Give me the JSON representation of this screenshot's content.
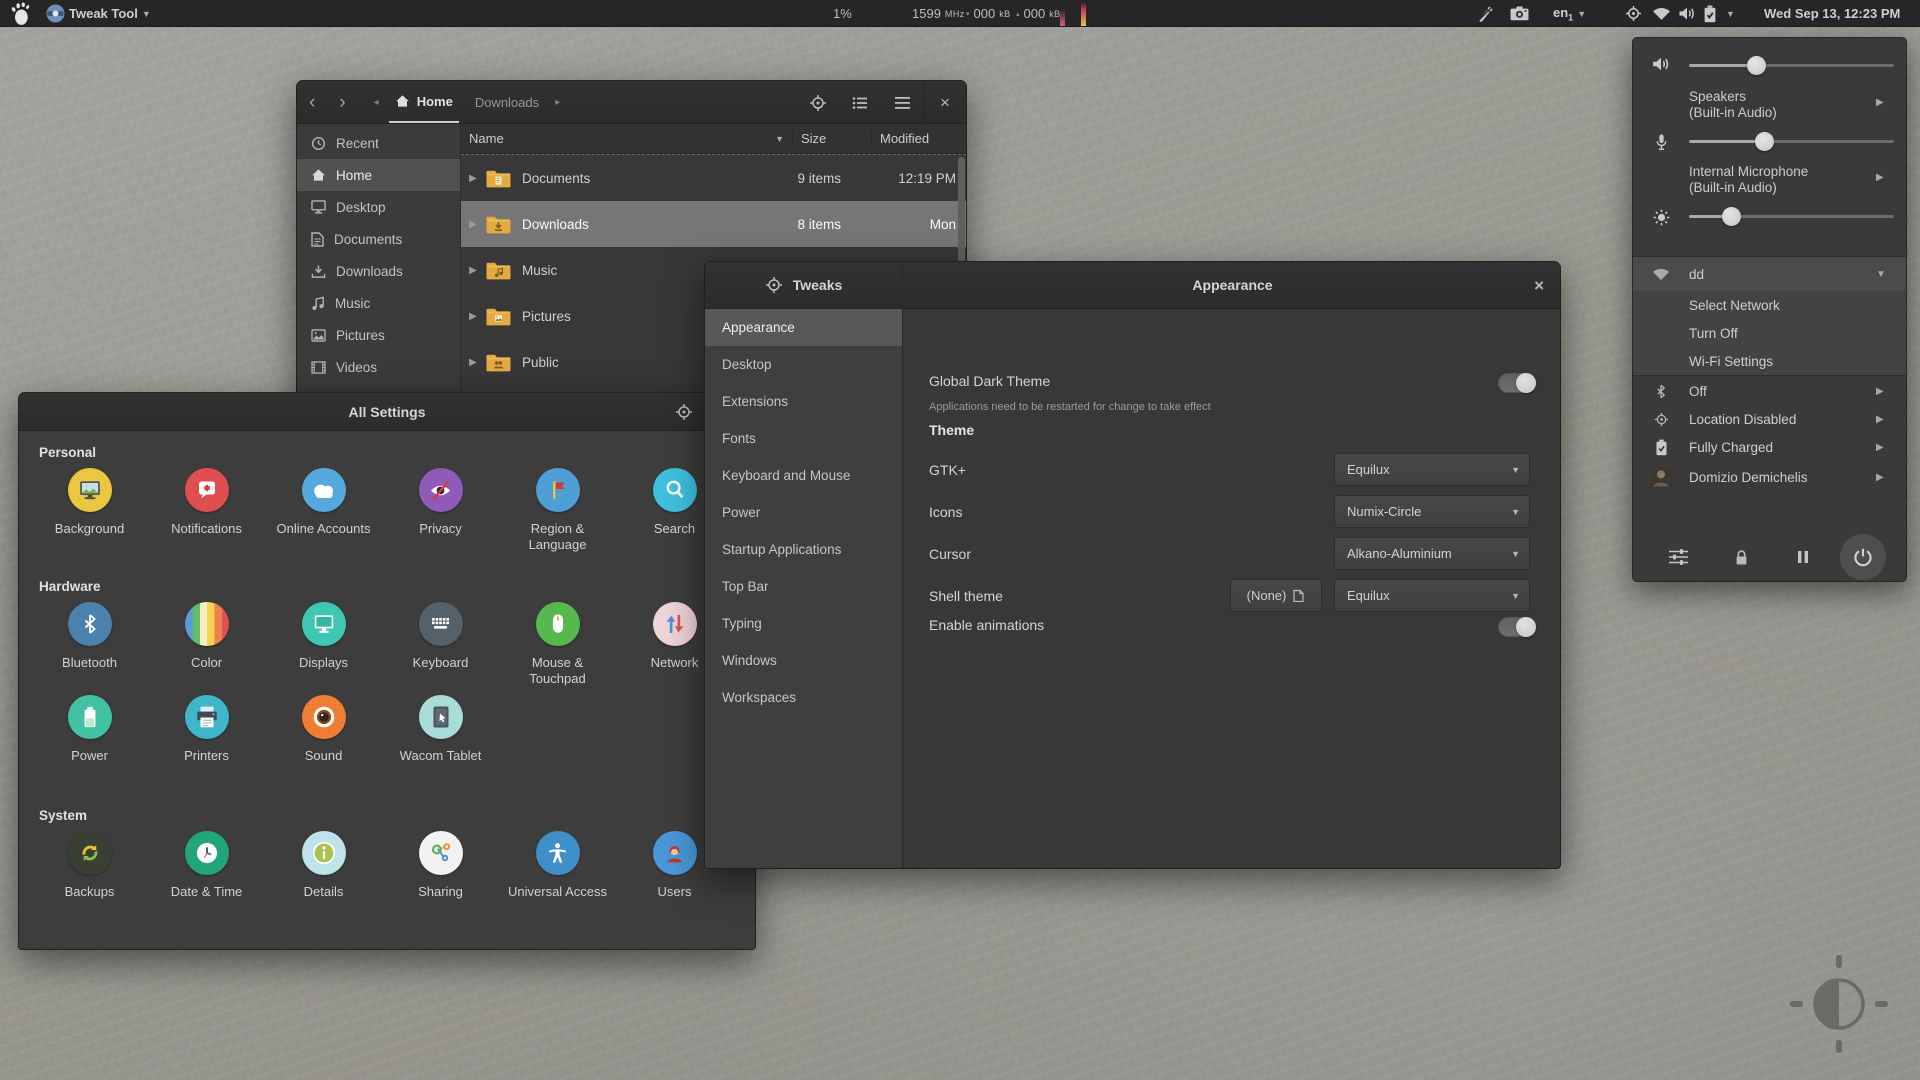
{
  "top_bar": {
    "app_menu_label": "Tweak Tool",
    "cpu_percent": "1%",
    "cpu_freq_value": "1599",
    "cpu_freq_unit": "MHz",
    "net_rx_value": "000",
    "net_rx_unit": "kB",
    "net_tx_value": "000",
    "net_tx_unit": "kB",
    "keyboard_layout": "en",
    "keyboard_layout_index": "1",
    "clock": "Wed Sep 13, 12:23 PM",
    "graph_colors": {
      "bar1": "#e05a86",
      "bar2": "#e8c53a"
    }
  },
  "files_window": {
    "breadcrumb": {
      "home": "Home",
      "current": "Downloads"
    },
    "sidebar": [
      {
        "label": "Recent"
      },
      {
        "label": "Home",
        "selected": true
      },
      {
        "label": "Desktop"
      },
      {
        "label": "Documents"
      },
      {
        "label": "Downloads"
      },
      {
        "label": "Music"
      },
      {
        "label": "Pictures"
      },
      {
        "label": "Videos"
      }
    ],
    "columns": {
      "name": "Name",
      "size": "Size",
      "modified": "Modified"
    },
    "rows": [
      {
        "name": "Documents",
        "size": "9 items",
        "modified": "12:19 PM",
        "selected": false
      },
      {
        "name": "Downloads",
        "size": "8 items",
        "modified": "Mon",
        "selected": true
      },
      {
        "name": "Music",
        "size": "",
        "modified": "",
        "selected": false
      },
      {
        "name": "Pictures",
        "size": "",
        "modified": "",
        "selected": false
      },
      {
        "name": "Public",
        "size": "",
        "modified": "",
        "selected": false
      }
    ],
    "folder_color": "#e3aa3f"
  },
  "settings_window": {
    "title": "All Settings",
    "sections": [
      {
        "label": "Personal",
        "items": [
          {
            "label": "Background",
            "color": "#e9c73f"
          },
          {
            "label": "Notifications",
            "color": "#e04f4f"
          },
          {
            "label": "Online Accounts",
            "color": "#54aade"
          },
          {
            "label": "Privacy",
            "color": "#8f5bb8"
          },
          {
            "label": "Region & Language",
            "color": "#4d9fd6"
          },
          {
            "label": "Search",
            "color": "#3fc0de"
          }
        ]
      },
      {
        "label": "Hardware",
        "items": [
          {
            "label": "Bluetooth",
            "color": "#4a82ad"
          },
          {
            "label": "Color",
            "color": "#cfd8dc"
          },
          {
            "label": "Displays",
            "color": "#3ec8b4"
          },
          {
            "label": "Keyboard",
            "color": "#566069"
          },
          {
            "label": "Mouse & Touchpad",
            "color": "#57b94d"
          },
          {
            "label": "Network",
            "color": "#eed3d7"
          },
          {
            "label": "Power",
            "color": "#41c2a5"
          },
          {
            "label": "Printers",
            "color": "#3fb6c9"
          },
          {
            "label": "Sound",
            "color": "#ef7d33"
          },
          {
            "label": "Wacom Tablet",
            "color": "#a8dcd9"
          }
        ]
      },
      {
        "label": "System",
        "items": [
          {
            "label": "Backups",
            "color": "#3a3f33"
          },
          {
            "label": "Date & Time",
            "color": "#23a57c"
          },
          {
            "label": "Details",
            "color": "#bfe3ea"
          },
          {
            "label": "Sharing",
            "color": "#f2f2f2"
          },
          {
            "label": "Universal Access",
            "color": "#3e8fc9"
          },
          {
            "label": "Users",
            "color": "#4a97d8"
          }
        ]
      }
    ]
  },
  "tweaks_window": {
    "title": "Tweaks",
    "sidebar": [
      "Appearance",
      "Desktop",
      "Extensions",
      "Fonts",
      "Keyboard and Mouse",
      "Power",
      "Startup Applications",
      "Top Bar",
      "Typing",
      "Windows",
      "Workspaces"
    ],
    "selected_item": "Appearance",
    "panel": {
      "title": "Appearance",
      "global_dark_theme_label": "Global Dark Theme",
      "global_dark_theme_note": "Applications need to be restarted for change to take effect",
      "global_dark_theme_on": true,
      "theme_heading": "Theme",
      "gtk_label": "GTK+",
      "gtk_value": "Equilux",
      "icons_label": "Icons",
      "icons_value": "Numix-Circle",
      "cursor_label": "Cursor",
      "cursor_value": "Alkano-Aluminium",
      "shell_label": "Shell theme",
      "shell_file_button": "(None)",
      "shell_value": "Equilux",
      "animations_label": "Enable animations",
      "animations_on": true
    }
  },
  "system_menu": {
    "volume_percent": 33,
    "microphone_percent": 37,
    "brightness_percent": 21,
    "output_device": "Speakers",
    "output_device_sub": "(Built-in Audio)",
    "input_device": "Internal Microphone",
    "input_device_sub": "(Built-in Audio)",
    "network_name": "dd",
    "network_items": [
      "Select Network",
      "Turn Off",
      "Wi-Fi Settings"
    ],
    "bluetooth_status": "Off",
    "location_status": "Location Disabled",
    "battery_status": "Fully Charged",
    "user_name": "Domizio Demichelis"
  }
}
